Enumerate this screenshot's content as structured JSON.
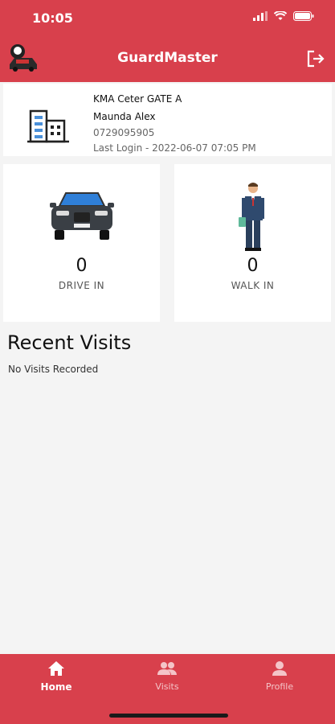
{
  "status_bar": {
    "time": "10:05"
  },
  "app": {
    "title": "GuardMaster"
  },
  "info": {
    "gate": "KMA Ceter GATE A",
    "name": "Maunda Alex",
    "phone": "0729095905",
    "last_login": "Last Login - 2022-06-07 07:05 PM"
  },
  "stats": {
    "drive_in": {
      "count": "0",
      "label": "DRIVE IN"
    },
    "walk_in": {
      "count": "0",
      "label": "WALK IN"
    }
  },
  "recent": {
    "title": "Recent Visits",
    "empty": "No Visits Recorded"
  },
  "nav": {
    "home": "Home",
    "visits": "Visits",
    "profile": "Profile"
  },
  "colors": {
    "brand": "#d8404c",
    "background": "#f4f4f4"
  }
}
